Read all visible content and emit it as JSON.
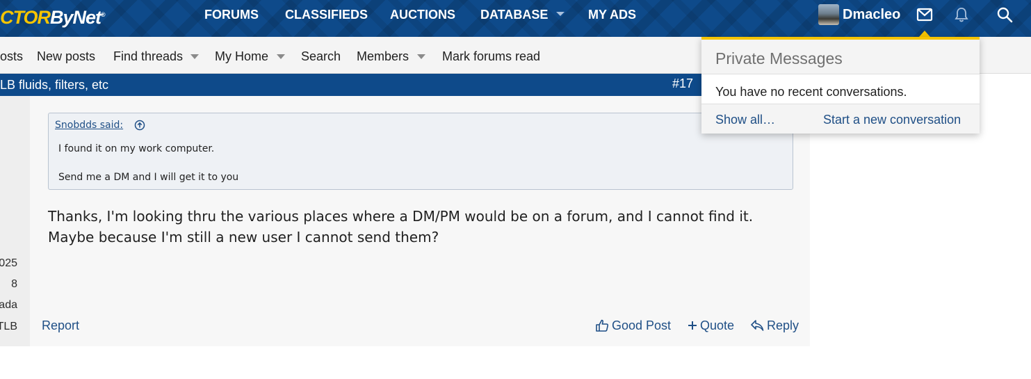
{
  "header": {
    "logo_part1": "CTOR",
    "logo_part2": "ByNet",
    "logo_reg": "®",
    "nav": {
      "forums": "FORUMS",
      "classifieds": "CLASSIFIEDS",
      "auctions": "AUCTIONS",
      "database": "DATABASE",
      "my_ads": "MY ADS"
    },
    "username": "Dmacleo",
    "icons": [
      "mail-icon",
      "bell-icon",
      "search-icon"
    ]
  },
  "subnav": {
    "posts": "osts",
    "new_posts": "New posts",
    "find_threads": "Find threads",
    "my_home": "My Home",
    "search": "Search",
    "members": "Members",
    "mark_forums_read": "Mark forums read"
  },
  "thread": {
    "title": "LB fluids, filters, etc",
    "post_number": "#17"
  },
  "post": {
    "left_meta": [
      "025",
      "8",
      "ada",
      "TLB"
    ],
    "quote": {
      "author": "Snobdds said:",
      "lines": [
        "I found it on my work computer.",
        "Send me a DM and I will get it to you"
      ]
    },
    "message": "Thanks, I'm looking thru the various places where a DM/PM would be on a forum, and I cannot find it. Maybe because I'm still a new user I cannot send them?",
    "actions": {
      "report": "Report",
      "good_post": "Good Post",
      "quote": "Quote",
      "reply": "Reply"
    }
  },
  "pm_popup": {
    "title": "Private Messages",
    "empty_text": "You have no recent conversations.",
    "show_all": "Show all…",
    "start_new": "Start a new conversation"
  },
  "colors": {
    "brand_blue": "#0e4a8a",
    "accent_yellow": "#f5c400",
    "link_blue": "#1f4f86"
  }
}
